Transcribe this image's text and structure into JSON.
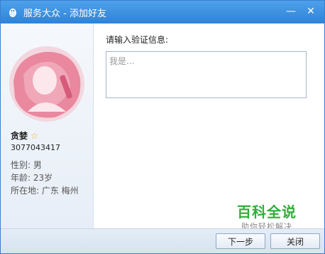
{
  "window": {
    "title": "服务大众 - 添加好友",
    "minimize_glyph": "—",
    "close_glyph": "✕"
  },
  "profile": {
    "name": "贪婪",
    "id": "3077043417",
    "gender": "性别: 男",
    "age": "年龄: 23岁",
    "location": "所在地: 广东  梅州",
    "badge_icon": "star-icon"
  },
  "form": {
    "prompt": "请输入验证信息:",
    "placeholder": "我是..."
  },
  "buttons": {
    "next": "下一步",
    "close": "关闭"
  },
  "watermark": {
    "title": "百科全说",
    "subtitle": "助你轻松解决"
  },
  "colors": {
    "titlebar": "#2f83d8",
    "watermark_green": "#2fae3a",
    "star": "#f5b21a"
  }
}
